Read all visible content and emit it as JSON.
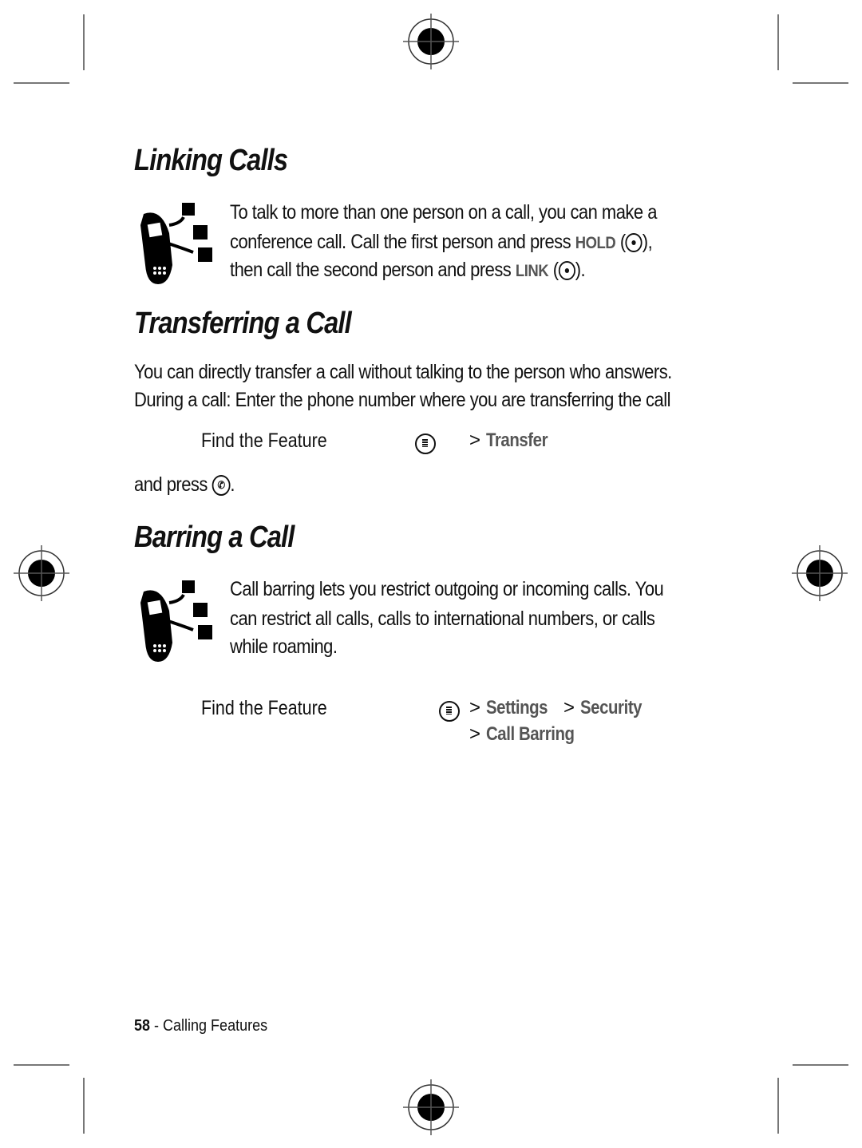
{
  "sections": [
    {
      "title": "Linking Calls",
      "lines": [
        "To talk to more than one person on a call, you can make a",
        "conference call. Call the first person and press ",
        "then call the second person and press "
      ],
      "key_hold": "HOLD",
      "key_link": "LINK",
      "icon": "phone-feature-icon"
    },
    {
      "title": "Transferring a Call",
      "lines": [
        "You can directly transfer a call without talking to the person who answers.",
        "During a call: Enter the phone number where you are transferring the call"
      ],
      "find_label": "Find the Feature",
      "path": [
        "Transfer"
      ],
      "after": "and press",
      "after_end": "."
    },
    {
      "title": "Barring a Call",
      "lines": [
        "Call barring lets you restrict outgoing or incoming calls. You",
        "can restrict all calls, calls to international numbers, or calls",
        "while roaming."
      ],
      "find_label": "Find the Feature",
      "path": [
        "Settings",
        "Security",
        "Call Barring"
      ],
      "icon": "phone-feature-icon"
    }
  ],
  "footer": {
    "page_number": "58",
    "separator": " - ",
    "section": "Calling Features"
  }
}
